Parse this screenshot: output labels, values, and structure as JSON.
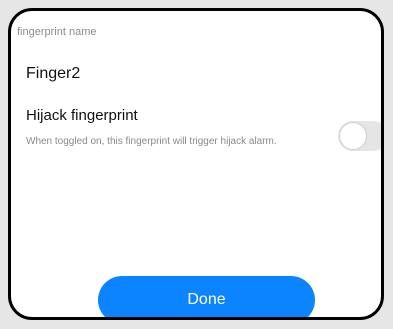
{
  "dialog": {
    "name_field": {
      "label": "fingerprint name",
      "value": "Finger2"
    },
    "hijack_option": {
      "title": "Hijack fingerprint",
      "description": "When toggled on, this fingerprint will trigger hijack alarm.",
      "enabled": false
    },
    "done_label": "Done"
  },
  "colors": {
    "accent": "#0d84ff",
    "toggle_off": "#e5e5e5",
    "label_gray": "#8c8c8c"
  }
}
